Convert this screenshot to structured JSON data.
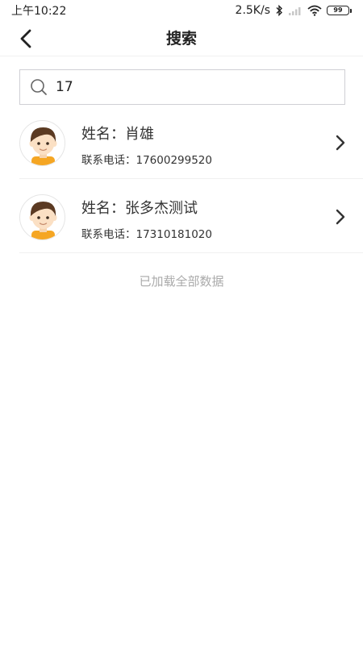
{
  "status_bar": {
    "time": "上午10:22",
    "network_speed": "2.5K/s",
    "battery_level": "99",
    "icons": [
      "bluetooth-icon",
      "signal-icon",
      "wifi-icon",
      "battery-icon"
    ]
  },
  "nav": {
    "title": "搜索",
    "back_icon": "chevron-left-icon"
  },
  "search": {
    "value": "17",
    "icon": "search-icon"
  },
  "contacts": [
    {
      "name_label": "姓名：",
      "name": "肖雄",
      "phone_label": "联系电话：",
      "phone": "17600299520"
    },
    {
      "name_label": "姓名：",
      "name": "张多杰测试",
      "phone_label": "联系电话：",
      "phone": "17310181020"
    }
  ],
  "footer": {
    "text": "已加载全部数据"
  },
  "colors": {
    "text_primary": "#333333",
    "text_muted": "#aaaaaa",
    "divider": "#f0f0f0",
    "search_border": "#cfcfd4",
    "avatar_hair": "#5b3a22",
    "avatar_shirt": "#f5a623"
  }
}
